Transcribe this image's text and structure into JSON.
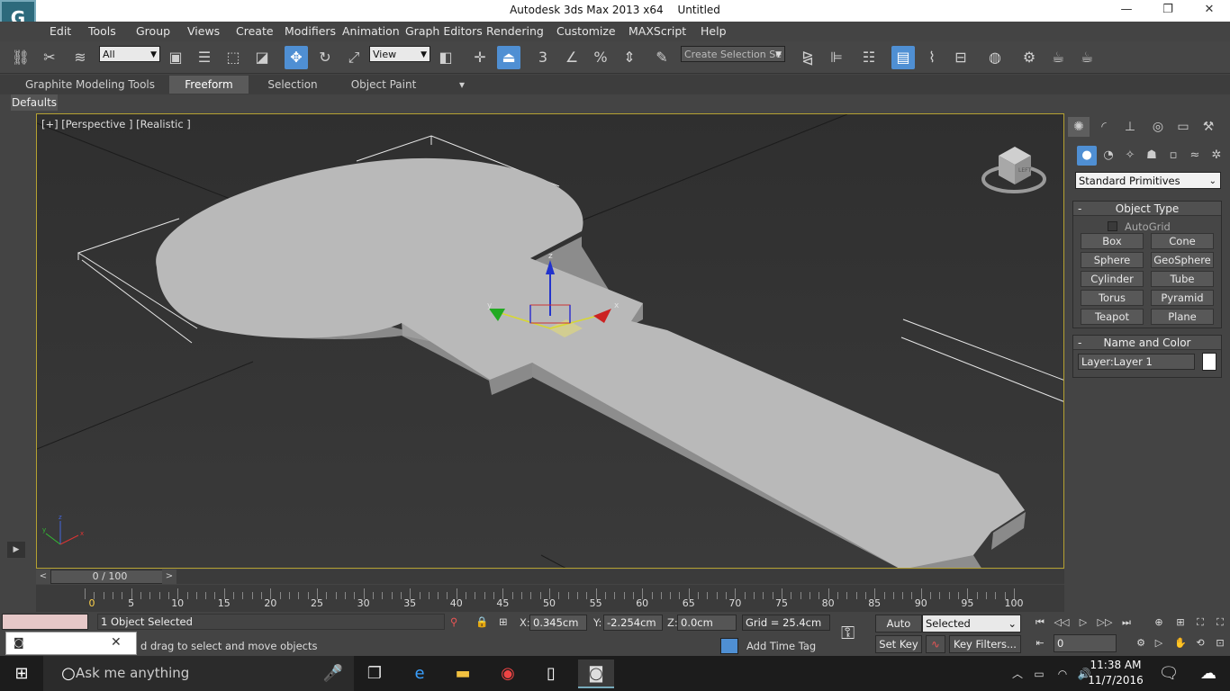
{
  "window": {
    "app_name": "Autodesk 3ds Max  2013 x64",
    "doc_name": "Untitled",
    "logo_glyph": "G",
    "controls": [
      "—",
      "❐",
      "✕"
    ]
  },
  "menu": [
    "Edit",
    "Tools",
    "Group",
    "Views",
    "Create",
    "Modifiers",
    "Animation",
    "Graph Editors",
    "Rendering",
    "Customize",
    "MAXScript",
    "Help"
  ],
  "toolbar": {
    "filter_value": "All",
    "coord_value": "View",
    "selection_set_placeholder": "Create Selection Se",
    "snap_label": "3"
  },
  "ribbon": {
    "tabs": [
      "Graphite Modeling Tools",
      "Freeform",
      "Selection",
      "Object Paint"
    ],
    "active_tab": "Freeform",
    "defaults_label": "Defaults"
  },
  "viewport": {
    "label": "[+] [Perspective ] [Realistic ]",
    "gizmo_axes": [
      "x",
      "y",
      "z"
    ],
    "viewcube_label": "LEFT"
  },
  "command_panel": {
    "category": "Standard Primitives",
    "object_type_title": "Object Type",
    "autogrid_label": "AutoGrid",
    "buttons": [
      "Box",
      "Cone",
      "Sphere",
      "GeoSphere",
      "Cylinder",
      "Tube",
      "Torus",
      "Pyramid",
      "Teapot",
      "Plane"
    ],
    "name_color_title": "Name and Color",
    "name_value": "Layer:Layer 1",
    "color": "#ffffff",
    "rollout_toggle": "-"
  },
  "timeline": {
    "frame_display": "0 / 100",
    "labels": [
      "0",
      "5",
      "10",
      "15",
      "20",
      "25",
      "30",
      "35",
      "40",
      "45",
      "50",
      "55",
      "60",
      "65",
      "70",
      "75",
      "80",
      "85",
      "90",
      "95",
      "100"
    ]
  },
  "status": {
    "selection": "1 Object Selected",
    "prompt": "d drag to select and move objects",
    "x_label": "X:",
    "x_value": "0.345cm",
    "y_label": "Y:",
    "y_value": "-2.254cm",
    "z_label": "Z:",
    "z_value": "0.0cm",
    "grid": "Grid = 25.4cm",
    "add_time_tag": "Add Time Tag"
  },
  "animation": {
    "auto_key": "Auto Key",
    "set_key": "Set Key",
    "selected": "Selected",
    "key_filters": "Key Filters...",
    "frame_value": "0"
  },
  "taskbar": {
    "search_placeholder": "Ask me anything",
    "time": "11:38 AM",
    "date": "11/7/2016"
  }
}
